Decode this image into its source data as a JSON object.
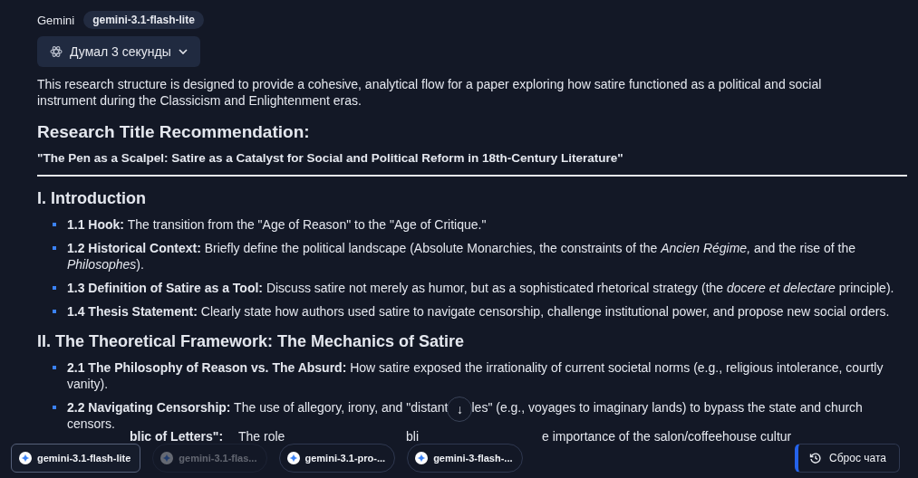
{
  "header": {
    "name": "Gemini",
    "model": "gemini-3.1-flash-lite"
  },
  "thinking": {
    "label": "Думал 3 секунды",
    "expanded": false
  },
  "intro": "This research structure is designed to provide a cohesive, analytical flow for a paper exploring how satire functioned as a political and social instrument during the Classicism and Enlightenment eras.",
  "title_heading": "Research Title Recommendation:",
  "title": "\"The Pen as a Scalpel: Satire as a Catalyst for Social and Political Reform in 18th-Century Literature\"",
  "sections": [
    {
      "heading": "I. Introduction",
      "items": [
        {
          "kind": "text",
          "label": "1.1 Hook:",
          "text": "The transition from the \"Age of Reason\" to the \"Age of Critique.\""
        },
        {
          "kind": "text",
          "label": "1.2 Historical Context:",
          "text": "Briefly define the political landscape (Absolute Monarchies, the constraints of the *Ancien Régime,* and the rise of the *Philosophes*)."
        },
        {
          "kind": "text",
          "label": "1.3 Definition of Satire as a Tool:",
          "text": "Discuss satire not merely as humor, but as a sophisticated rhetorical strategy (the *docere et delectare* principle)."
        },
        {
          "kind": "text",
          "label": "1.4 Thesis Statement:",
          "text": "Clearly state how authors used satire to navigate censorship, challenge institutional power, and propose new social orders."
        }
      ]
    },
    {
      "heading": "II. The Theoretical Framework: The Mechanics of Satire",
      "items": [
        {
          "kind": "text",
          "label": "2.1 The Philosophy of Reason vs. The Absurd:",
          "text": "How satire exposed the irrationality of current societal norms (e.g., religious intolerance, courtly vanity)."
        },
        {
          "kind": "split",
          "label": "2.2 Navigating Censorship:",
          "parts": [
            "The use of allegory, irony, and \"distant",
            "les\" (e.g., voyages to imaginary lands) to bypass the state and church censors."
          ]
        },
        {
          "kind": "fragments",
          "fragments": [
            {
              "text": "blic of Letters\":",
              "bold": true
            },
            {
              "text": "The role",
              "bold": false
            },
            {
              "text": "bli",
              "bold": false
            },
            {
              "text": "e importance of the salon/coffeehouse cultur",
              "bold": false
            }
          ]
        }
      ]
    }
  ],
  "scroll_button": "↓",
  "model_chips": [
    {
      "label": "gemini-3.1-flash-lite",
      "selected": true,
      "disabled": false
    },
    {
      "label": "gemini-3.1-flas...",
      "selected": false,
      "disabled": true
    },
    {
      "label": "gemini-3.1-pro-...",
      "selected": false,
      "disabled": false
    },
    {
      "label": "gemini-3-flash-...",
      "selected": false,
      "disabled": false
    }
  ],
  "reset_button": "Сброс чата"
}
